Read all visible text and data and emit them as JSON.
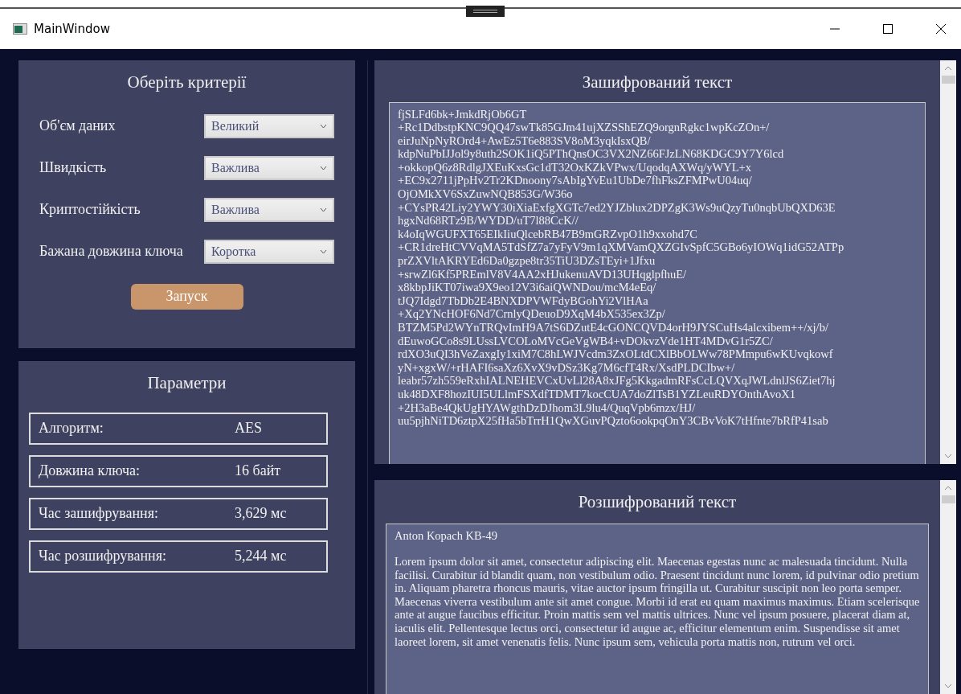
{
  "window": {
    "title": "MainWindow"
  },
  "criteria": {
    "title": "Оберіть критерії",
    "fields": [
      {
        "label": "Об'єм даних",
        "value": "Великий"
      },
      {
        "label": "Швидкість",
        "value": "Важлива"
      },
      {
        "label": "Криптостійкість",
        "value": "Важлива"
      },
      {
        "label": "Бажана довжина ключа",
        "value": "Коротка"
      }
    ],
    "button": "Запуск"
  },
  "parameters": {
    "title": "Параметри",
    "rows": [
      {
        "label": "Алгоритм:",
        "value": "AES"
      },
      {
        "label": "Довжина ключа:",
        "value": "16 байт"
      },
      {
        "label": "Час зашифрування:",
        "value": "3,629 мс"
      },
      {
        "label": "Час розшифрування:",
        "value": "5,244 мс"
      }
    ]
  },
  "encrypted": {
    "title": "Зашифрований текст",
    "lines": [
      "fjSLFd6bk+JmkdRjOb6GT",
      "+Rc1DdbstpKNC9QQ47swTk85GJm41ujXZSShEZQ9orgnRgkc1wpKcZOn+/",
      "eirJuNpNyROrd4+AwEz5T6e883SV8oM3yqkIsxQB/",
      "kdpNuPbIJJol9y8uth2SOK1iQ5PThQnsOC3VX2NZ66FJzLN68KDGC9Y7Y6lcd",
      "+okkopQ6z8RdlgJXEuKxsGc1dT32OxKZkVPwx/UqodqAXWq/yWYL+x",
      "+EC9x2711jPpHv2Tr2KDnoony7sAbIgYvEu1UbDe7fhFksZFMPwU04uq/",
      "OjOMkXV6SxZuwNQB853G/W36o",
      "+CYsPR42Liy2YWY30iXiaExfgXGTc7ed2YJZblux2DPZgK3Ws9uQzyTu0nqbUbQXD63E",
      "hgxNd68RTz9B/WYDD/uT7l88CcK//",
      "k4oIqWGUFXT65EIkIiuQlcebRB47B9mGRZvpO1h9xxohd7C",
      "+CR1dreHtCVVqMA5TdSfZ7a7yFyV9m1qXMVamQXZGIvSpfC5GBo6yIOWq1idG52ATPp",
      "prZXVltAKRYEd6Da0gzpe8tr35TiU3DZsTEyi+1Jfxu",
      "+srwZl6Kf5PREmlV8V4AA2xHJukenuAVD13UHqglpfhuE/",
      "x8kbpJiKT07iwa9X9eo12V3i6aiQWNDou/mcM4eEq/",
      "tJQ7Idgd7TbDb2E4BNXDPVWFdyBGohYi2VlHAa",
      "+Xq2YNcHOF6Nd7CrnlyQDeuoD9XqM4bX535ex3Zp/",
      "BTZM5Pd2WYnTRQvImH9A7tS6DZutE4cGONCQVD4orH9JYSCuHs4alcxibem++/xj/b/",
      "dEuwoGCo8s9LUssLVCOLoMVcGeVgWB4+vDOkvzVde1HT4MDvG1r5ZC/",
      "rdXO3uQI3hVeZaxgIy1xiM7C8hLWJVcdm3ZxOLtdCXlBbOLWw78PMmpu6wKUvqkowf",
      "yN+xgxW/+rHAFI6saXz6XvX9vDSz3Kg7M6cfT4Rx/XsdPLDCIbw+/",
      "leabr57zh559eRxhIALNEHEVCxUvLl28A8xJFg5KkgadmRFsCcLQVXqJWLdnlJS6Ziet7hj",
      "uk48DXF8hozIUI5ULlmFSXdfTDMT7kocCUA7doZlTsB1YZLeuRDYOnthAvoX1",
      "+2H3aBe4QkUgHYAWgthDzDJhom3L9lu4/QuqVpb6mzx/HJ/",
      "uu5pjhNiTD6ztpX25fHa5bTrrH1QwXGuvPQzto6ookpqOnY3CBvVoK7tHfnte7bRfP41sab"
    ]
  },
  "decrypted": {
    "title": "Розшифрований текст",
    "paragraphs": [
      "Anton Kopach KB-49",
      "Lorem ipsum dolor sit amet, consectetur adipiscing elit. Maecenas egestas nunc ac malesuada tincidunt. Nulla facilisi. Curabitur id blandit quam, non vestibulum odio. Praesent tincidunt nunc lorem, id pulvinar odio pretium in. Aliquam pharetra rhoncus mauris, vitae auctor ipsum fringilla ut. Curabitur suscipit non leo porta semper. Maecenas viverra vestibulum ante sit amet congue. Morbi id erat eu quam maximus maximus. Etiam scelerisque ante at augue faucibus efficitur. Proin mattis sem vel mattis ultrices. Nunc vel ipsum posuere, placerat diam at, iaculis elit. Pellentesque lectus orci, consectetur id augue ac, efficitur elementum enim. Suspendisse sit amet laoreet lorem, sit amet venenatis felis. Nunc ipsum sem, vehicula porta mattis non, rutrum vel orci."
    ]
  }
}
